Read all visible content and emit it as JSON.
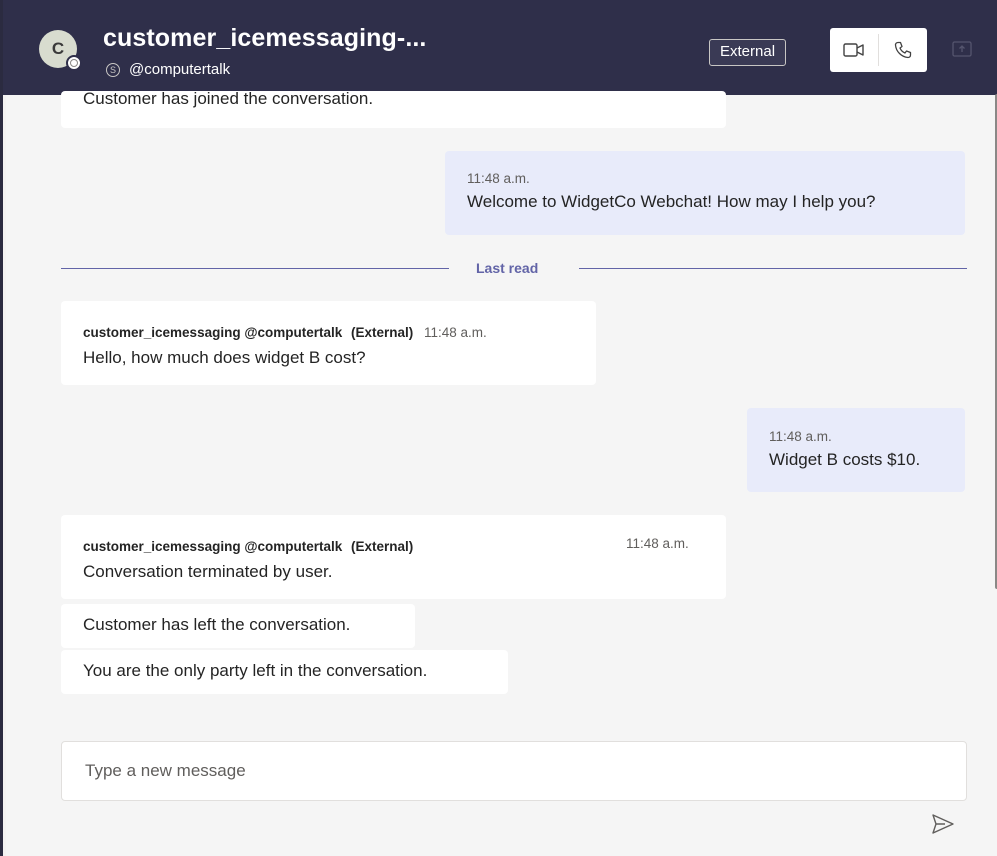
{
  "header": {
    "avatar_initial": "C",
    "title": "customer_icemessaging-...",
    "subtitle": "@computertalk",
    "skype_glyph": "S",
    "external_badge": "External",
    "colors": {
      "bar": "#2f2f4a",
      "accent": "#6264a7"
    }
  },
  "messages": {
    "m0": {
      "text": "Customer has joined the conversation."
    },
    "m1": {
      "time": "11:48 a.m.",
      "text": "Welcome to WidgetCo Webchat! How may I help you?"
    },
    "last_read": "Last read",
    "m2": {
      "sender": "customer_icemessaging @computertalk",
      "ext": "(External)",
      "time": "11:48 a.m.",
      "text": "Hello, how much does widget B cost?"
    },
    "m3": {
      "time": "11:48 a.m.",
      "text": "Widget B costs $10."
    },
    "m4": {
      "sender": "customer_icemessaging @computertalk",
      "ext": "(External)",
      "time": "11:48 a.m.",
      "text": "Conversation terminated by user."
    },
    "m5": {
      "text": "Customer has left the conversation."
    },
    "m6": {
      "text": "You are the only party left in the conversation."
    }
  },
  "composer": {
    "placeholder": "Type a new message"
  },
  "icons": {
    "video": "video-call-icon",
    "phone": "audio-call-icon",
    "share": "share-screen-icon",
    "send": "send-icon"
  }
}
